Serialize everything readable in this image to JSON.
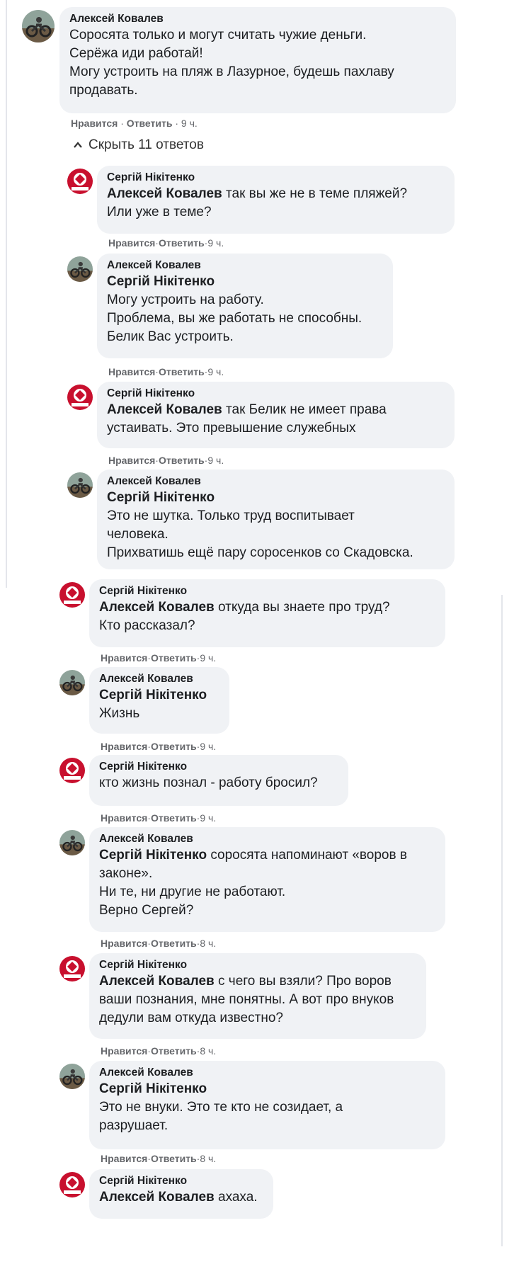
{
  "comment": {
    "author": "Алексей Ковалев",
    "lines": [
      "Соросята только и могут считать чужие деньги.",
      "Серёжа иди работай!",
      "Могу устроить на пляж в Лазурное, будешь пахлаву",
      "продавать."
    ],
    "like": "Нравится",
    "reply": "Ответить",
    "time": "9 ч.",
    "sep": "·"
  },
  "toggle": {
    "label": "Скрыть 11 ответов"
  },
  "replies": [
    {
      "author": "Сергій Нікітенко",
      "mention": "Алексей Ковалев",
      "lines": [
        " так вы же не в теме пляжей?",
        "Или уже в теме?"
      ],
      "like": "Нравится",
      "reply": "Ответить",
      "time": "9 ч."
    },
    {
      "author": "Алексей Ковалев",
      "mention": "Сергій Нікітенко",
      "lines": [
        "Могу устроить на работу.",
        "Проблема, вы же работать не способны.",
        "Белик Вас устроить."
      ],
      "like": "Нравится",
      "reply": "Ответить",
      "time": "9 ч."
    },
    {
      "author": "Сергій Нікітенко",
      "mention": "Алексей Ковалев",
      "lines": [
        " так Белик не имеет права",
        "устаивать. Это превышение служебных"
      ],
      "like": "Нравится",
      "reply": "Ответить",
      "time": "9 ч."
    },
    {
      "author": "Алексей Ковалев",
      "mention": "Сергій Нікітенко",
      "lines": [
        "Это не шутка. Только труд воспитывает",
        "человека.",
        "Прихватишь ещё пару соросенков со Скадовска."
      ]
    },
    {
      "author": "Сергій Нікітенко",
      "mention": "Алексей Ковалев",
      "lines": [
        " откуда вы знаете про труд?",
        "Кто рассказал?"
      ],
      "like": "Нравится",
      "reply": "Ответить",
      "time": "9 ч."
    },
    {
      "author": "Алексей Ковалев",
      "mention": "Сергій Нікітенко",
      "lines": [
        "Жизнь"
      ],
      "like": "Нравится",
      "reply": "Ответить",
      "time": "9 ч."
    },
    {
      "author": "Сергій Нікітенко",
      "mention": "",
      "lines": [
        "кто жизнь познал - работу бросил?"
      ],
      "like": "Нравится",
      "reply": "Ответить",
      "time": "9 ч."
    },
    {
      "author": "Алексей Ковалев",
      "mention": "Сергій Нікітенко",
      "lines": [
        " соросята напоминают «воров в",
        "законе».",
        "Ни те, ни другие не работают.",
        "Верно Сергей?"
      ],
      "like": "Нравится",
      "reply": "Ответить",
      "time": "8 ч."
    },
    {
      "author": "Сергій Нікітенко",
      "mention": "Алексей Ковалев",
      "lines": [
        " с чего вы взяли? Про воров",
        "ваши познания, мне понятны. А вот про внуков",
        "дедули вам откуда известно?"
      ],
      "like": "Нравится",
      "reply": "Ответить",
      "time": "8 ч."
    },
    {
      "author": "Алексей Ковалев",
      "mention": "Сергій Нікітенко",
      "lines": [
        "Это не внуки. Это те кто не созидает, а",
        "разрушает."
      ],
      "like": "Нравится",
      "reply": "Ответить",
      "time": "8 ч."
    },
    {
      "author": "Сергій Нікітенко",
      "mention": "Алексей Ковалев",
      "lines": [
        " ахаха."
      ]
    }
  ],
  "colors": {
    "bubble": "#f0f2f5",
    "text": "#1c1e21",
    "meta": "#65676b",
    "avatar_red": "#c8102e"
  },
  "icons": {
    "toggle": "chevron-up-icon",
    "kovalev_avatar": "motorcycle-photo-avatar",
    "nikitenko_avatar": "red-logo-avatar"
  }
}
